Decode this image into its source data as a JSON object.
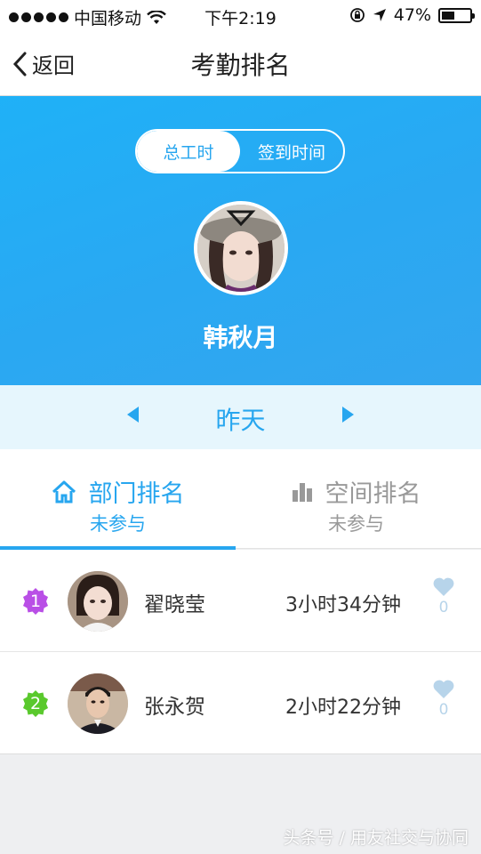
{
  "status_bar": {
    "carrier": "中国移动",
    "time": "下午2:19",
    "battery": "47%",
    "icons": [
      "signal-dots-icon",
      "wifi-icon",
      "rotation-lock-icon",
      "location-arrow-icon",
      "battery-icon"
    ]
  },
  "nav": {
    "back_label": "返回",
    "title": "考勤排名"
  },
  "segment": {
    "active_label": "总工时",
    "inactive_label": "签到时间"
  },
  "profile": {
    "name": "韩秋月"
  },
  "date_nav": {
    "label": "昨天"
  },
  "tabs": [
    {
      "label": "部门排名",
      "status": "未参与",
      "icon": "home-icon",
      "active": true
    },
    {
      "label": "空间排名",
      "status": "未参与",
      "icon": "building-icon",
      "active": false
    }
  ],
  "ranking": [
    {
      "rank": "1",
      "name": "翟晓莹",
      "duration": "3小时34分钟",
      "likes": "0",
      "badge_color": "#b94fe6"
    },
    {
      "rank": "2",
      "name": "张永贺",
      "duration": "2小时22分钟",
      "likes": "0",
      "badge_color": "#5ac92d"
    }
  ],
  "watermark": "头条号 / 用友社交与协同",
  "colors": {
    "accent": "#27a6ef",
    "hero_bg": "#2aa8f2",
    "date_bar_bg": "#e6f6fd",
    "like_heart": "#b7d4ea"
  }
}
